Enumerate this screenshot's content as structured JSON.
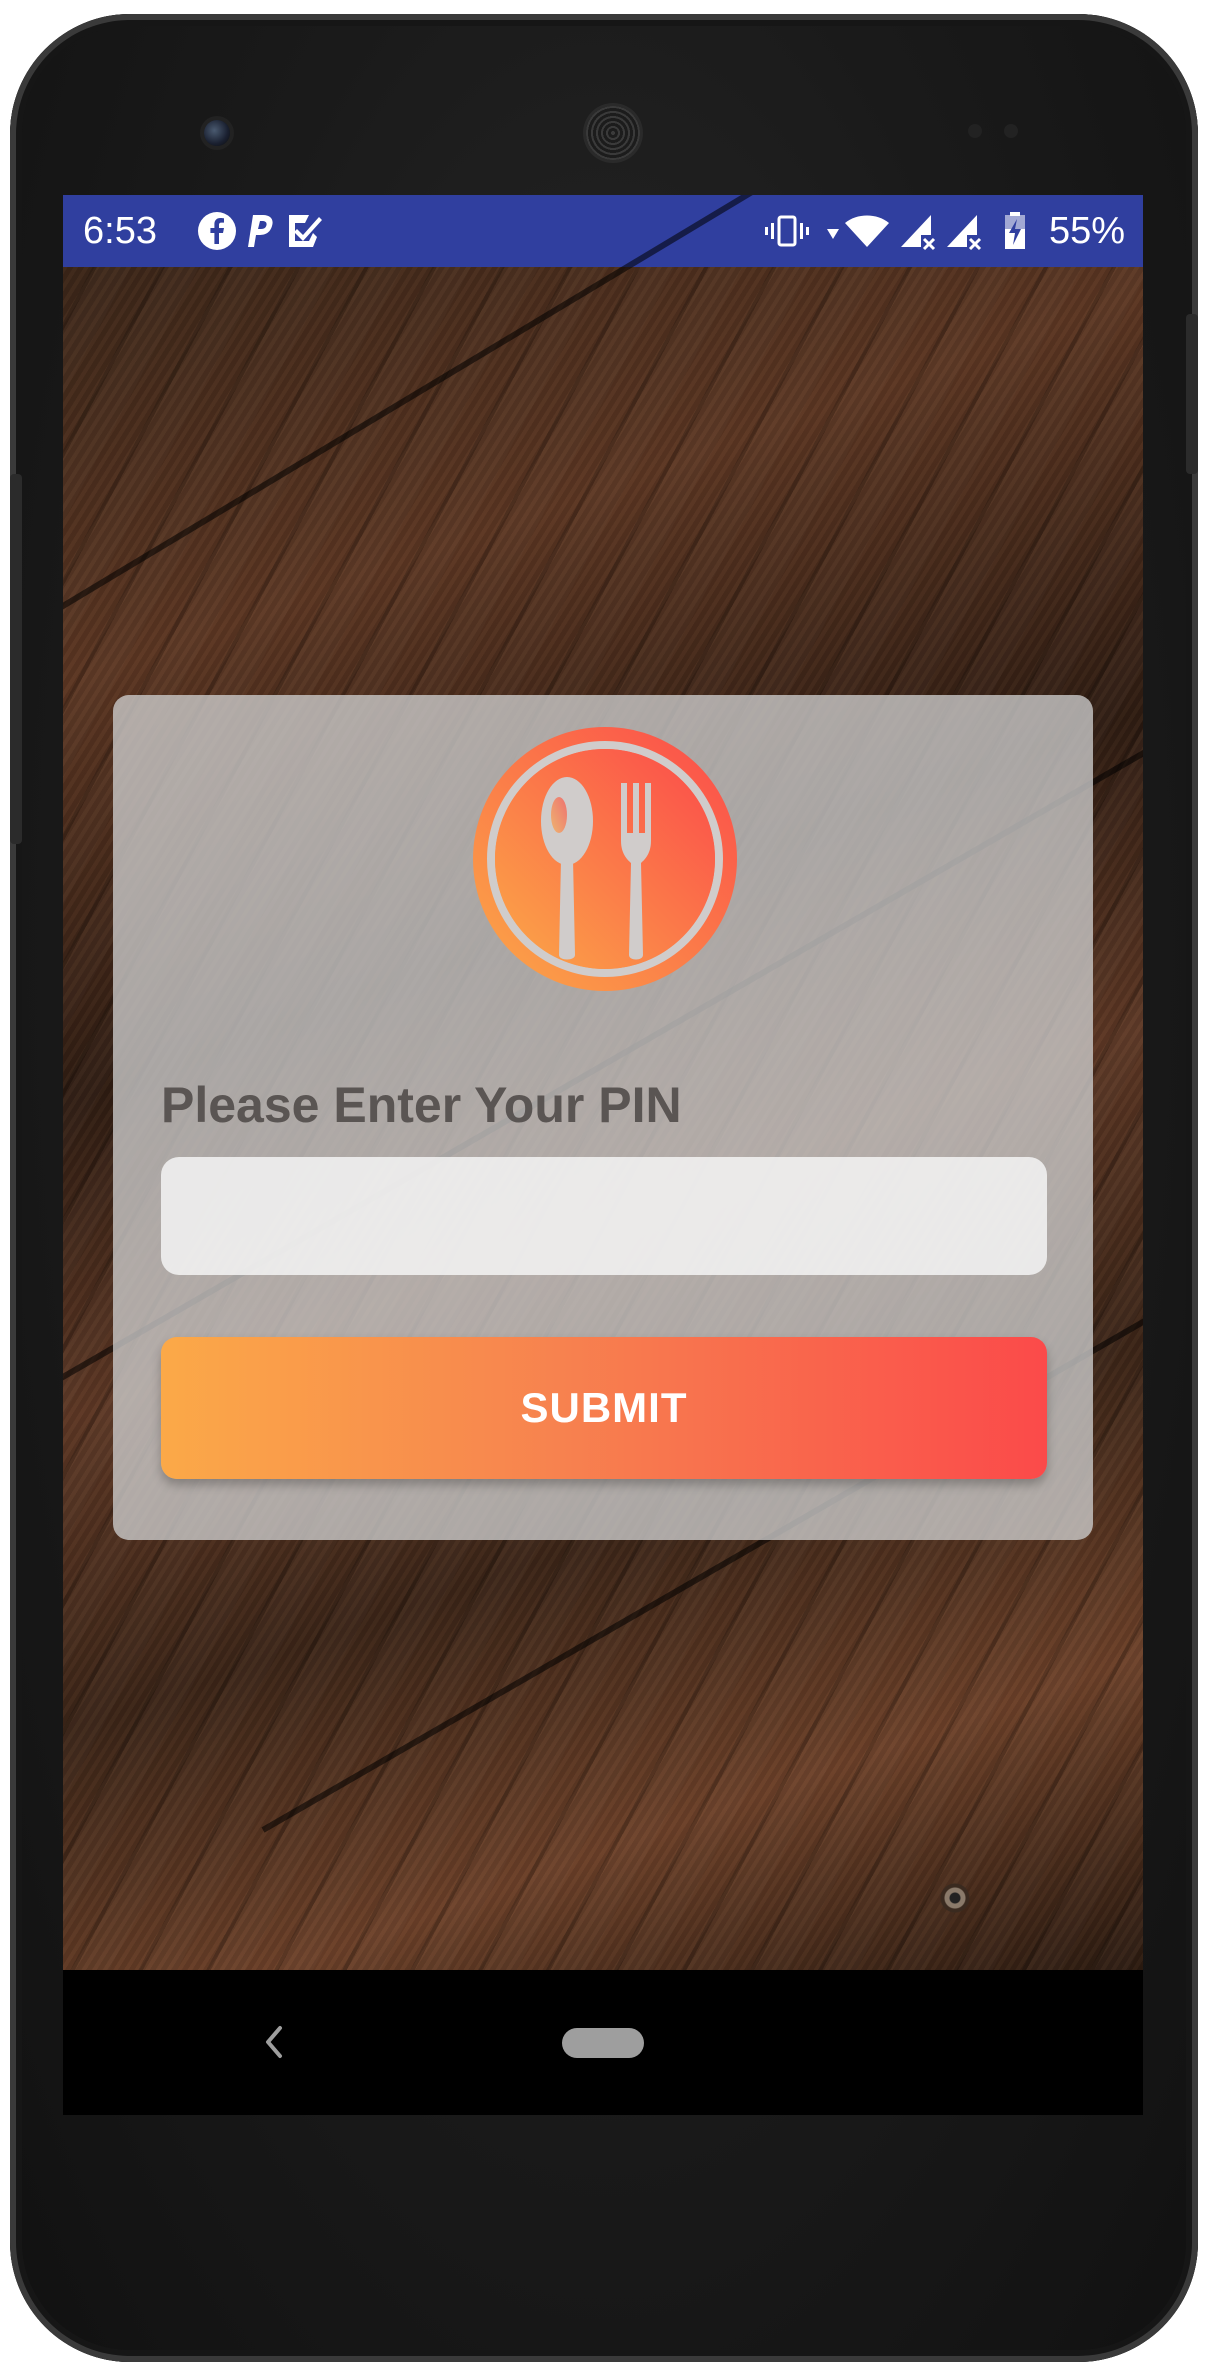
{
  "status_bar": {
    "time": "6:53",
    "battery": "55%",
    "background_color": "#303f9f",
    "left_icons": [
      "facebook-icon",
      "paypal-icon",
      "tasks-check-icon"
    ],
    "right_icons": [
      "vibrate-icon",
      "wifi-icon",
      "signal-no-data-icon",
      "signal-no-data-icon",
      "battery-charging-icon"
    ]
  },
  "login": {
    "logo_icon": "spoon-fork-icon",
    "prompt": "Please Enter Your PIN",
    "pin_value": "",
    "pin_placeholder": "",
    "submit_label": "SUBMIT",
    "accent_start": "#fba948",
    "accent_end": "#fb4a4a"
  },
  "nav_bar": {
    "back_icon": "chevron-left-icon",
    "home_icon": "home-pill-icon"
  }
}
